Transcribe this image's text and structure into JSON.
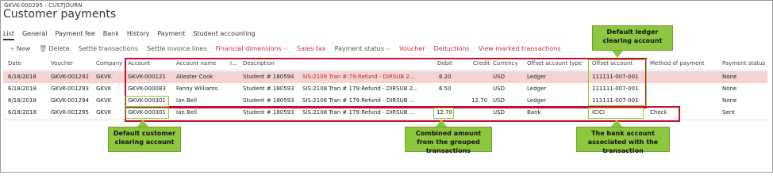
{
  "breadcrumb": "GKVK-000295 : CUSTJOURN",
  "title": "Customer payments",
  "tabs": [
    "List",
    "General",
    "Payment fee",
    "Bank",
    "History",
    "Payment",
    "Student accounting"
  ],
  "toolbar": {
    "new": "New",
    "delete": "Delete",
    "settle_transactions": "Settle transactions",
    "settle_invoice_lines": "Settle invoice lines",
    "financial_dimensions": "Financial dimensions",
    "sales_tax": "Sales tax",
    "payment_status": "Payment status",
    "voucher": "Voucher",
    "deductions": "Deductions",
    "view_marked": "View marked transactions"
  },
  "columns": {
    "date": "Date",
    "voucher": "Voucher",
    "company": "Company",
    "account": "Account",
    "account_name": "Account name",
    "i": "I...",
    "description": "Description",
    "debit": "Debit",
    "credit": "Credit",
    "currency": "Currency",
    "offset_account_type": "Offset account type",
    "offset_account": "Offset account",
    "method_of_payment": "Method of payment",
    "payment_status": "Payment status"
  },
  "rows": [
    {
      "date": "6/18/2018",
      "voucher": "GKVK-001292",
      "company": "GKVK",
      "account": "GKVK-000121",
      "account_name": "Aliester Cook",
      "student": "Student # 180594",
      "description": "SIS:2109 Tran #:79:Refund - DIRSUB 2...",
      "debit": "6.20",
      "credit": "",
      "currency": "USD",
      "offset_type": "Ledger",
      "offset_account": "111111-007-001",
      "method": "",
      "status": "None"
    },
    {
      "date": "6/18/2018",
      "voucher": "GKVK-001293",
      "company": "GKVK",
      "account": "GKVK-000083",
      "account_name": "Fanny Williams",
      "student": "Student # 180593",
      "description": "SIS:2108 Tran # 179:Refund - DIRSUB 2...",
      "debit": "6.50",
      "credit": "",
      "currency": "USD",
      "offset_type": "Ledger",
      "offset_account": "111111-007-001",
      "method": "",
      "status": "None"
    },
    {
      "date": "6/18/2018",
      "voucher": "GKVK-001294",
      "company": "GKVK",
      "account": "GKVK-000301",
      "account_name": "Ian Bell",
      "student": "Student # 180593",
      "description": "SIS:2108 Tran # 179:Refund - DIRSUB ...",
      "debit": "",
      "credit": "12.70",
      "currency": "USD",
      "offset_type": "Ledger",
      "offset_account": "111111-007-001",
      "method": "",
      "status": "None"
    },
    {
      "date": "6/18/2018",
      "voucher": "GKVK-001295",
      "company": "GKVK",
      "account": "GKVK-000301",
      "account_name": "Ian Bell",
      "student": "Student # 180593",
      "description": "SIS:2108 Tran # 179:Refund - DIRSUB ...",
      "debit": "12.70",
      "credit": "",
      "currency": "USD",
      "offset_type": "Bank",
      "offset_account": "ICICI",
      "method": "Check",
      "status": "Sent"
    }
  ],
  "callouts": {
    "ledger": "Default ledger clearing account",
    "customer": "Default customer clearing account",
    "combined": "Combined amount from the grouped transactions",
    "bank": "The bank account associated with the transaction"
  },
  "colors": {
    "accent_red": "#c8102e",
    "callout_green": "#8dc63f",
    "selected_row": "#f4d3d3",
    "link_red": "#c0392b"
  }
}
